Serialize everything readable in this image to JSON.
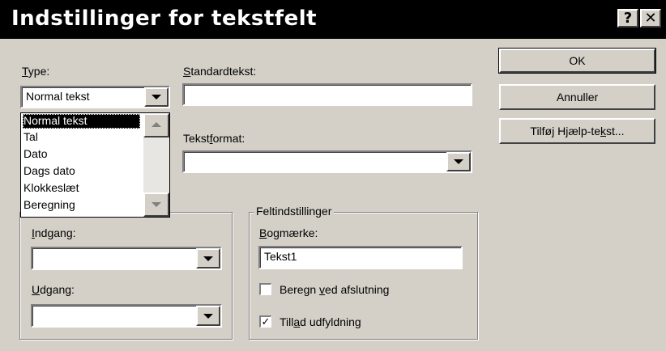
{
  "window": {
    "title": "Indstillinger for tekstfelt",
    "help_glyph": "?",
    "close_glyph": "✕"
  },
  "type": {
    "label_mnemonic": "T",
    "label_rest": "ype:",
    "selected": "Normal tekst",
    "options": [
      "Normal tekst",
      "Tal",
      "Dato",
      "Dags dato",
      "Klokkeslæt",
      "Beregning"
    ]
  },
  "standardtekst": {
    "label_mnemonic": "S",
    "label_rest": "tandardtekst:",
    "value": ""
  },
  "tekstformat": {
    "label_pre": "Tekst",
    "label_mnemonic": "f",
    "label_post": "ormat:",
    "value": ""
  },
  "buttons": {
    "ok": "OK",
    "annuller": "Annuller",
    "help_pre": "Tilføj Hjælp-te",
    "help_mnemonic": "k",
    "help_post": "st..."
  },
  "makroer": {
    "indgang_mnemonic": "I",
    "indgang_rest": "ndgang:",
    "indgang_value": "",
    "udgang_mnemonic": "U",
    "udgang_rest": "dgang:",
    "udgang_value": ""
  },
  "feltindstillinger": {
    "title": "Feltindstillinger",
    "bogmaerke_mnemonic": "B",
    "bogmaerke_rest": "ogmærke:",
    "bogmaerke_value": "Tekst1",
    "beregn_pre": "Beregn ",
    "beregn_mnemonic": "v",
    "beregn_post": "ed afslutning",
    "beregn_checked": false,
    "tillad_pre": "Till",
    "tillad_mnemonic": "a",
    "tillad_post": "d udfyldning",
    "tillad_checked": true,
    "check_glyph": "✓"
  }
}
